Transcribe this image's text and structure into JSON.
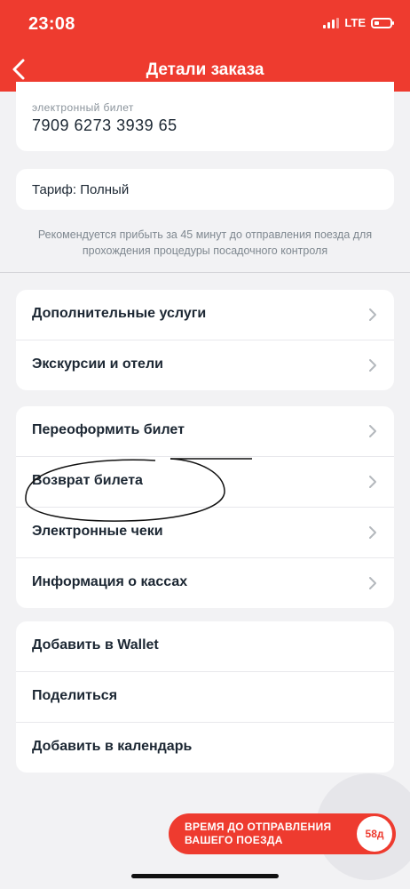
{
  "status_bar": {
    "time": "23:08",
    "network": "LTE"
  },
  "header": {
    "title": "Детали заказа",
    "back_icon": "chevron-left-icon"
  },
  "ticket": {
    "label": "электронный билет",
    "number": "7909 6273 3939 65"
  },
  "tariff": {
    "text": "Тариф: Полный"
  },
  "note": {
    "text": "Рекомендуется прибыть за 45 минут до отправления поезда для прохождения процедуры посадочного контроля"
  },
  "groups": {
    "services": {
      "items": [
        "Дополнительные услуги",
        "Экскурсии и отели"
      ]
    },
    "ticket_actions": {
      "items": [
        "Переоформить билет",
        "Возврат билета",
        "Электронные чеки",
        "Информация о кассах"
      ]
    },
    "share": {
      "items": [
        "Добавить в Wallet",
        "Поделиться",
        "Добавить в календарь"
      ]
    }
  },
  "countdown": {
    "label": "ВРЕМЯ ДО ОТПРАВЛЕНИЯ ВАШЕГО ПОЕЗДА",
    "value": "58д"
  },
  "colors": {
    "accent": "#ee3b2f",
    "background": "#f2f2f4",
    "card": "#ffffff",
    "text": "#1c2733",
    "muted": "#8a939b"
  }
}
